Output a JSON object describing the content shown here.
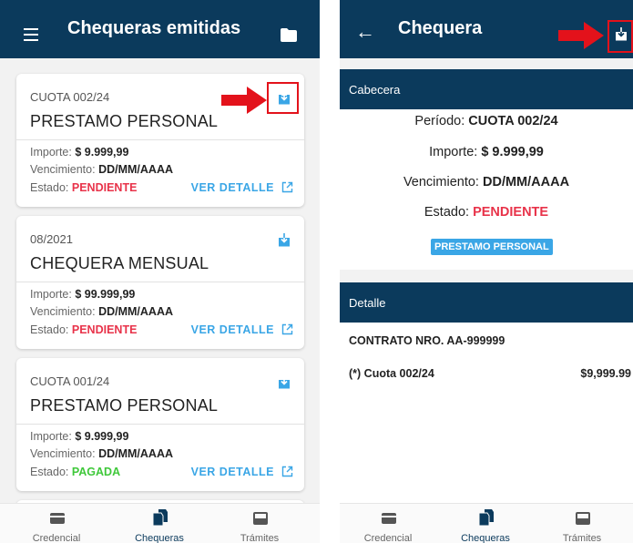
{
  "left_screen": {
    "title": "Chequeras emitidas",
    "cards": [
      {
        "period": "CUOTA 002/24",
        "name": "PRESTAMO PERSONAL",
        "importe_label": "Importe:",
        "importe_value": "$ 9.999,99",
        "vencimiento_label": "Vencimiento:",
        "vencimiento_value": "DD/MM/AAAA",
        "estado_label": "Estado:",
        "estado_value": "PENDIENTE",
        "detail_link": "VER DETALLE"
      },
      {
        "period": "08/2021",
        "name": "CHEQUERA MENSUAL",
        "importe_label": "Importe:",
        "importe_value": "$ 99.999,99",
        "vencimiento_label": "Vencimiento:",
        "vencimiento_value": "DD/MM/AAAA",
        "estado_label": "Estado:",
        "estado_value": "PENDIENTE",
        "detail_link": "VER DETALLE"
      },
      {
        "period": "CUOTA 001/24",
        "name": "PRESTAMO PERSONAL",
        "importe_label": "Importe:",
        "importe_value": "$ 9.999,99",
        "vencimiento_label": "Vencimiento:",
        "vencimiento_value": "DD/MM/AAAA",
        "estado_label": "Estado:",
        "estado_value": "PAGADA",
        "detail_link": "VER DETALLE"
      }
    ]
  },
  "right_screen": {
    "title": "Chequera",
    "cabecera": {
      "heading": "Cabecera",
      "periodo_label": "Período:",
      "periodo_value": "CUOTA 002/24",
      "importe_label": "Importe:",
      "importe_value": "$ 9.999,99",
      "vencimiento_label": "Vencimiento:",
      "vencimiento_value": "DD/MM/AAAA",
      "estado_label": "Estado:",
      "estado_value": "PENDIENTE",
      "tag": "PRESTAMO PERSONAL"
    },
    "detalle": {
      "heading": "Detalle",
      "contract": "CONTRATO NRO. AA-999999",
      "item_label": "(*) Cuota 002/24",
      "item_amount": "$9,999.99"
    }
  },
  "bottom_nav": {
    "items": [
      {
        "label": "Credencial",
        "icon": "credential-card-icon"
      },
      {
        "label": "Chequeras",
        "icon": "chequeras-icon"
      },
      {
        "label": "Trámites",
        "icon": "tramites-icon"
      }
    ]
  },
  "colors": {
    "header": "#0b3a5c",
    "accent": "#3aa6e6",
    "pending": "#e8334a",
    "paid": "#3fc83a",
    "annotation": "#e3121b"
  }
}
